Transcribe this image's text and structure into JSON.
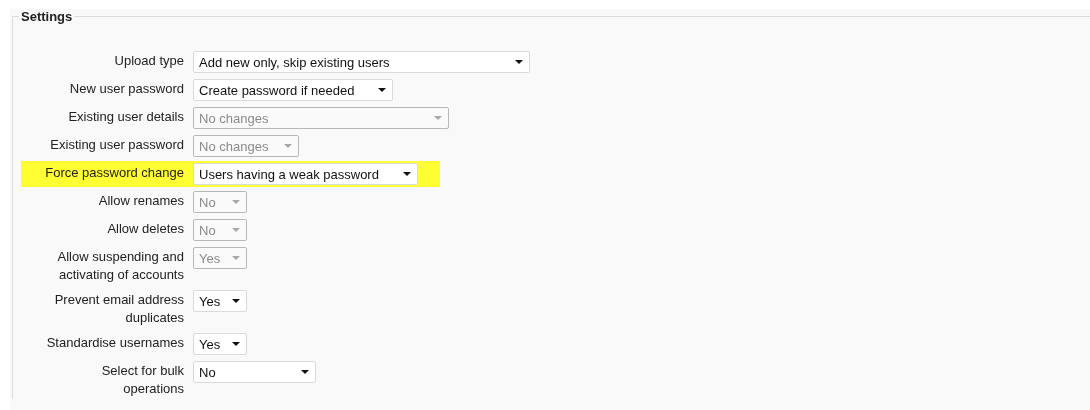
{
  "section": {
    "legend": "Settings"
  },
  "settings": [
    {
      "label": "Upload type",
      "value": "Add new only, skip existing users",
      "disabled": false,
      "highlighted": false
    },
    {
      "label": "New user password",
      "value": "Create password if needed",
      "disabled": false,
      "highlighted": false
    },
    {
      "label": "Existing user details",
      "value": "No changes",
      "disabled": true,
      "highlighted": false
    },
    {
      "label": "Existing user password",
      "value": "No changes",
      "disabled": true,
      "highlighted": false
    },
    {
      "label": "Force password change",
      "value": "Users having a weak password",
      "disabled": false,
      "highlighted": true
    },
    {
      "label": "Allow renames",
      "value": "No",
      "disabled": true,
      "highlighted": false
    },
    {
      "label": "Allow deletes",
      "value": "No",
      "disabled": true,
      "highlighted": false
    },
    {
      "label": "Allow suspending and activating of accounts",
      "value": "Yes",
      "disabled": true,
      "highlighted": false
    },
    {
      "label": "Prevent email address duplicates",
      "value": "Yes",
      "disabled": false,
      "highlighted": false
    },
    {
      "label": "Standardise usernames",
      "value": "Yes",
      "disabled": false,
      "highlighted": false
    },
    {
      "label": "Select for bulk operations",
      "value": "No",
      "disabled": false,
      "highlighted": false
    }
  ]
}
